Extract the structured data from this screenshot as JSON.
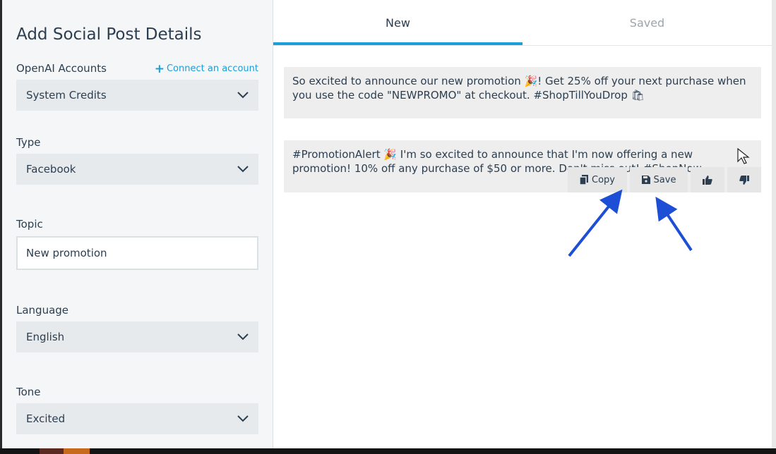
{
  "form": {
    "title": "Add Social Post Details",
    "openai_label": "OpenAI Accounts",
    "connect_link": "Connect an account",
    "openai_value": "System Credits",
    "type_label": "Type",
    "type_value": "Facebook",
    "topic_label": "Topic",
    "topic_value": "New promotion",
    "language_label": "Language",
    "language_value": "English",
    "tone_label": "Tone",
    "tone_value": "Excited"
  },
  "tabs": [
    {
      "label": "New",
      "active": true
    },
    {
      "label": "Saved",
      "active": false
    }
  ],
  "posts": [
    {
      "text": "So excited to announce our new promotion 🎉! Get 25% off your next purchase when you use the code \"NEWPROMO\" at checkout. #ShopTillYouDrop 🛍"
    },
    {
      "text": "#PromotionAlert 🎉 I'm so excited to announce that I'm now offering a new promotion! 10% off any purchase of $50 or more. Do",
      "text_tail": "n't miss out! #ShopNow"
    }
  ],
  "actions": {
    "copy_label": "Copy",
    "save_label": "Save"
  },
  "colors": {
    "accent": "#1a9fd8",
    "arrow": "#1c4fd6"
  }
}
